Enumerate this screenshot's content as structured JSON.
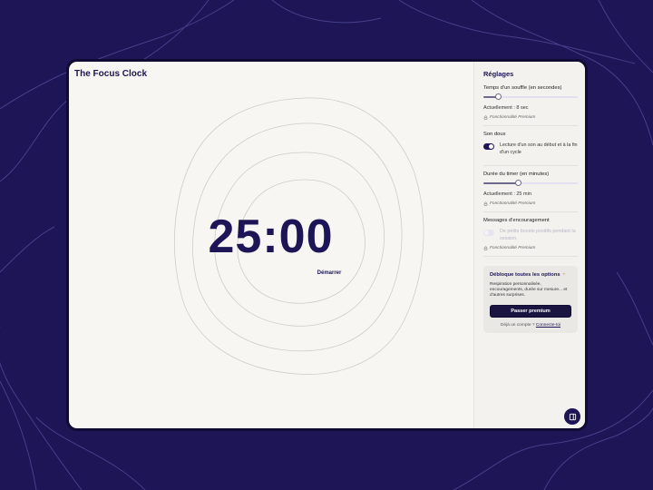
{
  "app": {
    "title": "The Focus Clock"
  },
  "timer": {
    "display": "25:00",
    "start_label": "Démarrer"
  },
  "settings": {
    "title": "Réglages",
    "breath": {
      "label": "Temps d'un souffle (en secondes)",
      "slider_fraction": 0.15,
      "current": "Actuellement : 8 sec",
      "premium_note": "Fonctionnalité Premium"
    },
    "sound": {
      "label": "Son doux",
      "enabled": true,
      "description": "Lecture d'un son au début et à la fin d'un cycle"
    },
    "duration": {
      "label": "Durée du timer (en minutes)",
      "slider_fraction": 0.37,
      "current": "Actuellement : 25 min",
      "premium_note": "Fonctionnalité Premium"
    },
    "encouragement": {
      "label": "Messages d'encouragement",
      "enabled": false,
      "description": "De petits boosts positifs pendant la session.",
      "premium_note": "Fonctionnalité Premium"
    }
  },
  "upsell": {
    "title": "Débloque toutes les options",
    "sparkle": "✦",
    "text": "Respiration personnalisée, encouragements, durée sur mesure... et d'autres surprises.",
    "button_label": "Passer premium",
    "login_prompt": "Déjà un compte ?",
    "login_link": "Connecte-toi"
  },
  "colors": {
    "background": "#1d1556",
    "accent": "#1d1556",
    "screen": "#f7f6f2"
  },
  "icons": {
    "lock": "lock-icon",
    "fab": "sidebar-toggle-icon"
  }
}
